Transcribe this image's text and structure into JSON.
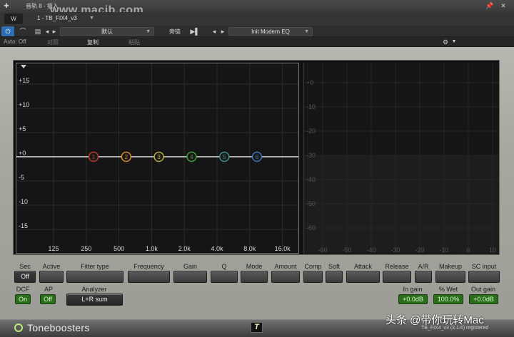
{
  "host": {
    "track_title": "音轨 8 - 插入",
    "preset_slot": "1 - TB_FIX4_v3",
    "preset_default": "默认",
    "sidechain_label": "旁链",
    "preset_name": "Init Modern EQ",
    "auto_label": "Auto: Off",
    "compare_label": "对照",
    "copy_label": "复制",
    "paste_label": "粘贴",
    "icons": [
      "plus-icon",
      "power-icon",
      "headphones-icon",
      "list-icon",
      "arrow-left-icon",
      "arrow-right-icon",
      "pin-icon",
      "close-icon",
      "gear-icon"
    ]
  },
  "graph": {
    "y_ticks": [
      "+15",
      "+10",
      "+5",
      "+0",
      "-5",
      "-10",
      "-15"
    ],
    "x_ticks": [
      "125",
      "250",
      "500",
      "1.0k",
      "2.0k",
      "4.0k",
      "8.0k",
      "16.0k"
    ],
    "bands": [
      {
        "label": "1",
        "color": "#c0392b"
      },
      {
        "label": "2",
        "color": "#d88a2d"
      },
      {
        "label": "3",
        "color": "#b6b23a"
      },
      {
        "label": "4",
        "color": "#3e9e3e"
      },
      {
        "label": "5",
        "color": "#3e8f84"
      },
      {
        "label": "6",
        "color": "#3b73b8"
      }
    ]
  },
  "meter": {
    "y_ticks": [
      "+0",
      "-10",
      "-20",
      "-30",
      "-40",
      "-50",
      "-60"
    ],
    "x_ticks": [
      "-60",
      "-50",
      "-40",
      "-30",
      "-20",
      "-10",
      "0",
      "10"
    ]
  },
  "controls": {
    "row1": [
      {
        "name": "sec",
        "label": "Sec",
        "value": "Off"
      },
      {
        "name": "active",
        "label": "Active",
        "value": ""
      },
      {
        "name": "filter-type",
        "label": "Filter type",
        "value": ""
      },
      {
        "name": "frequency",
        "label": "Frequency",
        "value": ""
      },
      {
        "name": "gain",
        "label": "Gain",
        "value": ""
      },
      {
        "name": "q",
        "label": "Q",
        "value": ""
      },
      {
        "name": "mode",
        "label": "Mode",
        "value": ""
      },
      {
        "name": "amount",
        "label": "Amount",
        "value": ""
      },
      {
        "name": "comp",
        "label": "Comp",
        "value": ""
      },
      {
        "name": "soft",
        "label": "Soft",
        "value": ""
      },
      {
        "name": "attack",
        "label": "Attack",
        "value": ""
      },
      {
        "name": "release",
        "label": "Release",
        "value": ""
      },
      {
        "name": "ar",
        "label": "A/R",
        "value": ""
      },
      {
        "name": "makeup",
        "label": "Makeup",
        "value": ""
      },
      {
        "name": "sc-input",
        "label": "SC input",
        "value": ""
      }
    ],
    "dcf": {
      "label": "DCF",
      "value": "On"
    },
    "ap": {
      "label": "AP",
      "value": "Off"
    },
    "analyzer": {
      "label": "Analyzer",
      "value": "L+R sum"
    },
    "in_gain": {
      "label": "In gain",
      "value": "+0.0dB"
    },
    "wet": {
      "label": "% Wet",
      "value": "100.0%"
    },
    "out_gain": {
      "label": "Out gain",
      "value": "+0.0dB"
    }
  },
  "footer": {
    "brand": "Toneboosters",
    "logo_letter": "T",
    "version": "TB_FIX4_v3 (3.1.6) registered"
  },
  "watermarks": {
    "url": "www.macjb.com",
    "caption": "头条 @带你玩转Mac"
  }
}
